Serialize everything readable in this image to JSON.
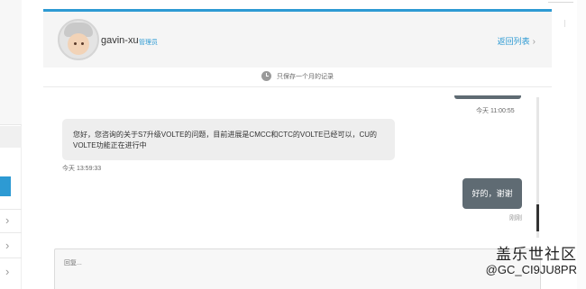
{
  "header": {
    "username": "gavin-xu",
    "role": "管理员",
    "back_link": "返回列表"
  },
  "notice": {
    "text": "只保存一个月的记录"
  },
  "messages": [
    {
      "side": "right",
      "time": "今天 11:00:55"
    },
    {
      "side": "left",
      "text": "您好，您咨询的关于S7升级VOLTE的问题，目前进展是CMCC和CTC的VOLTE已经可以，CU的VOLTE功能正在进行中",
      "time": "今天 13:59:33"
    },
    {
      "side": "right",
      "text": "好的，谢谢",
      "status": "刚刚"
    }
  ],
  "reply": {
    "placeholder": "回复..."
  },
  "watermark": {
    "line1": "盖乐世社区",
    "line2": "@GC_CI9JU8PR"
  },
  "colors": {
    "accent": "#2d9ad3",
    "bubble_dark": "#5f6b73",
    "bubble_light": "#eeeeee"
  }
}
